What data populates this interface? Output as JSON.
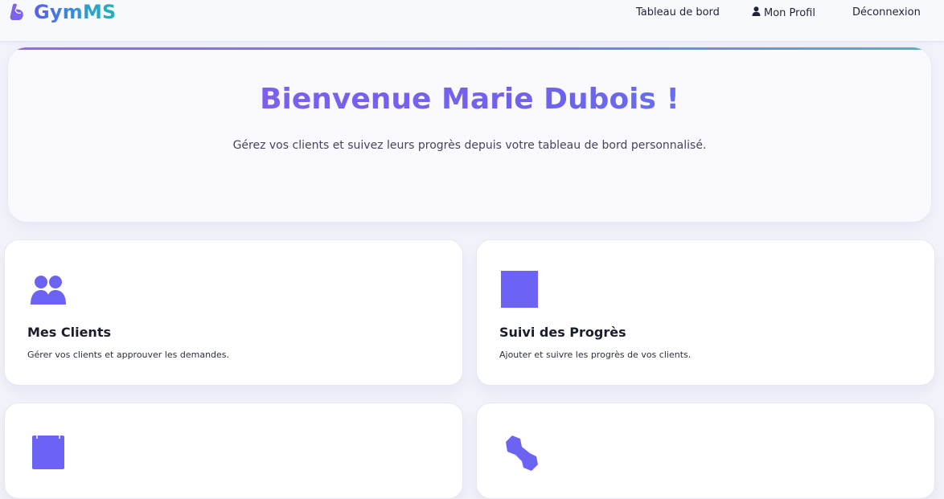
{
  "brand": {
    "name": "GymMS",
    "icon": "flexed-biceps-icon"
  },
  "nav": {
    "dashboard_label": "Tableau de bord",
    "profile_label": "Mon Profil",
    "profile_icon": "user-icon",
    "logout_label": "Déconnexion"
  },
  "hero": {
    "title": "Bienvenue Marie Dubois !",
    "subtitle": "Gérez vos clients et suivez leurs progrès depuis votre tableau de bord personnalisé."
  },
  "cards": [
    {
      "icon": "users-icon",
      "title": "Mes Clients",
      "description": "Gérer vos clients et approuver les demandes."
    },
    {
      "icon": "square-chart-icon",
      "title": "Suivi des Progrès",
      "description": "Ajouter et suivre les progrès de vos clients."
    },
    {
      "icon": "calendar-icon",
      "title": "",
      "description": ""
    },
    {
      "icon": "wrench-icon",
      "title": "",
      "description": ""
    }
  ],
  "colors": {
    "accent": "#6c63f5",
    "accent_gradient_end": "#23b1b8",
    "background": "#f3f4fb"
  }
}
